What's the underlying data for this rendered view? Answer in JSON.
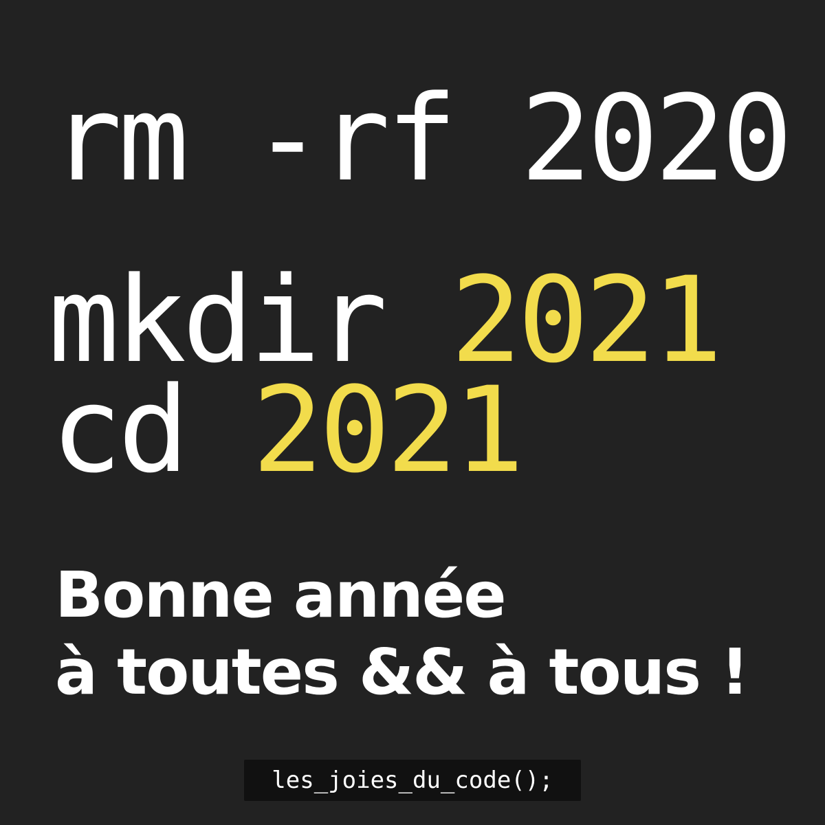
{
  "terminal": {
    "line1": {
      "command": "rm -rf ",
      "arg": "2020"
    },
    "line2": {
      "command": "mkdir ",
      "arg": "2021"
    },
    "line3": {
      "command": "cd ",
      "arg": "2021"
    }
  },
  "greeting": {
    "line1": "Bonne année",
    "line2": "à toutes && à tous !"
  },
  "footer": {
    "brand": "les_joies_du_code();"
  },
  "colors": {
    "background": "#222222",
    "text": "#ffffff",
    "accent": "#f2dc4c",
    "footer_background": "#111111"
  }
}
